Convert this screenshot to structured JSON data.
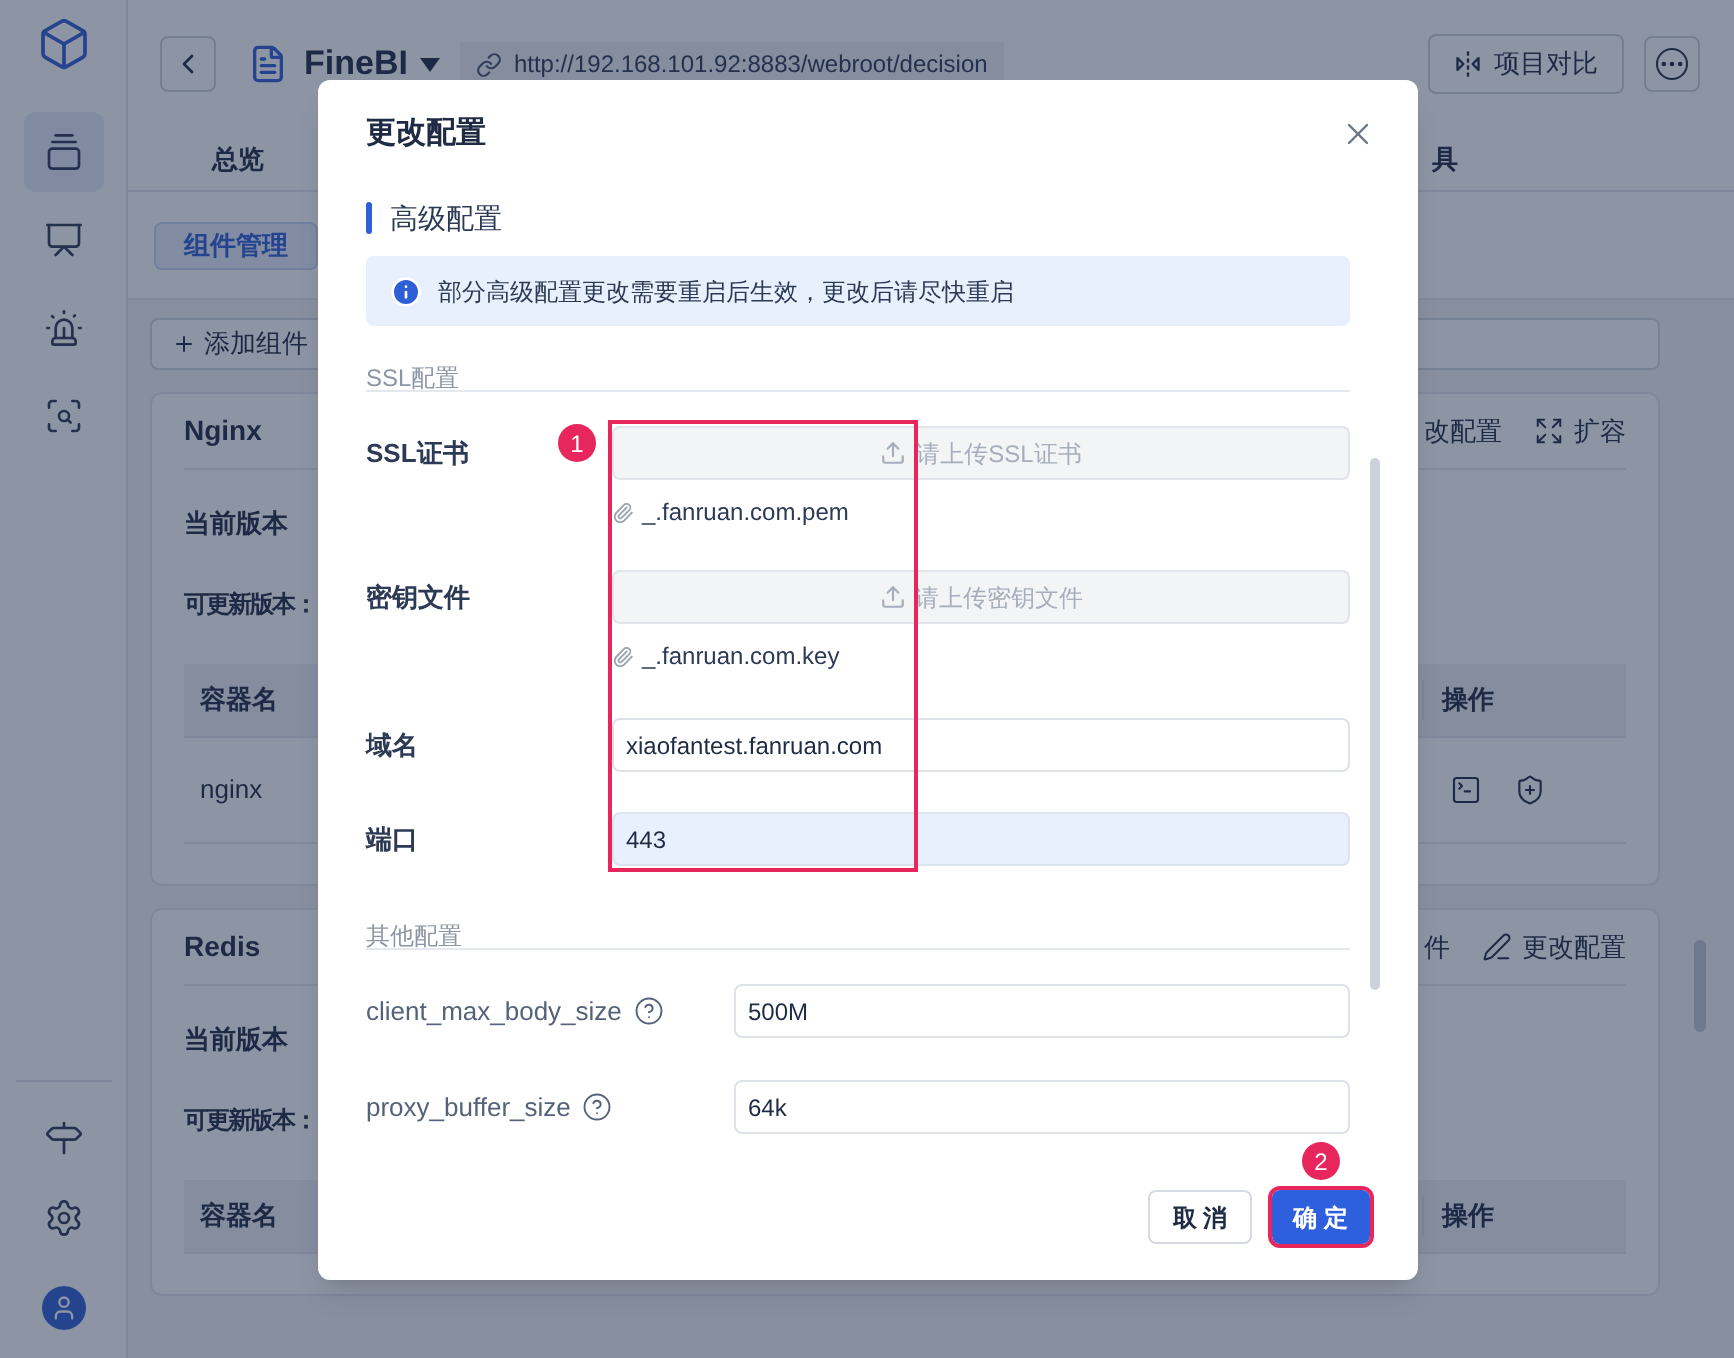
{
  "sidebar": {
    "items": [
      {
        "selected": true
      },
      {
        "selected": false
      },
      {
        "selected": false
      },
      {
        "selected": false
      }
    ]
  },
  "header": {
    "app_name": "FineBI",
    "url": "http://192.168.101.92:8883/webroot/decision",
    "compare_button": "项目对比"
  },
  "tabs": [
    {
      "label": "总览"
    },
    {
      "label": "具"
    }
  ],
  "subtabs": [
    {
      "label": "组件管理",
      "selected": true
    }
  ],
  "add_button": "添加组件",
  "components": [
    {
      "name": "Nginx",
      "actions": [
        {
          "label": "改配置"
        },
        {
          "label": "扩容"
        }
      ],
      "current_version": "当前版本",
      "updatable_version": "可更新版本：",
      "columns": [
        "容器名",
        "操作"
      ],
      "rows": [
        {
          "name": "nginx"
        }
      ]
    },
    {
      "name": "Redis",
      "actions": [
        {
          "label": "件"
        },
        {
          "label": "更改配置"
        }
      ],
      "current_version": "当前版本",
      "updatable_version": "可更新版本：",
      "columns": [
        "容器名",
        "操作"
      ]
    }
  ],
  "dialog": {
    "title": "更改配置",
    "section_title": "高级配置",
    "notice": "部分高级配置更改需要重启后生效，更改后请尽快重启",
    "groups": [
      {
        "title": "SSL配置",
        "fields": [
          {
            "kind": "upload",
            "label": "SSL证书",
            "placeholder": "请上传SSL证书",
            "file": "_.fanruan.com.pem"
          },
          {
            "kind": "upload",
            "label": "密钥文件",
            "placeholder": "请上传密钥文件",
            "file": "_.fanruan.com.key"
          },
          {
            "kind": "text",
            "label": "域名",
            "value": "xiaofantest.fanruan.com",
            "highlighted": false
          },
          {
            "kind": "text",
            "label": "端口",
            "value": "443",
            "highlighted": true
          }
        ]
      },
      {
        "title": "其他配置",
        "fields": [
          {
            "kind": "text",
            "label": "client_max_body_size",
            "help": true,
            "value": "500M",
            "highlighted": false
          },
          {
            "kind": "text",
            "label": "proxy_buffer_size",
            "help": true,
            "value": "64k",
            "highlighted": false
          }
        ]
      }
    ],
    "buttons": [
      {
        "label": "取 消",
        "primary": false,
        "annotated": false
      },
      {
        "label": "确 定",
        "primary": true,
        "annotated": true
      }
    ],
    "annotations": [
      {
        "label": "1",
        "kind": "box"
      },
      {
        "label": "2",
        "kind": "badge"
      }
    ]
  }
}
